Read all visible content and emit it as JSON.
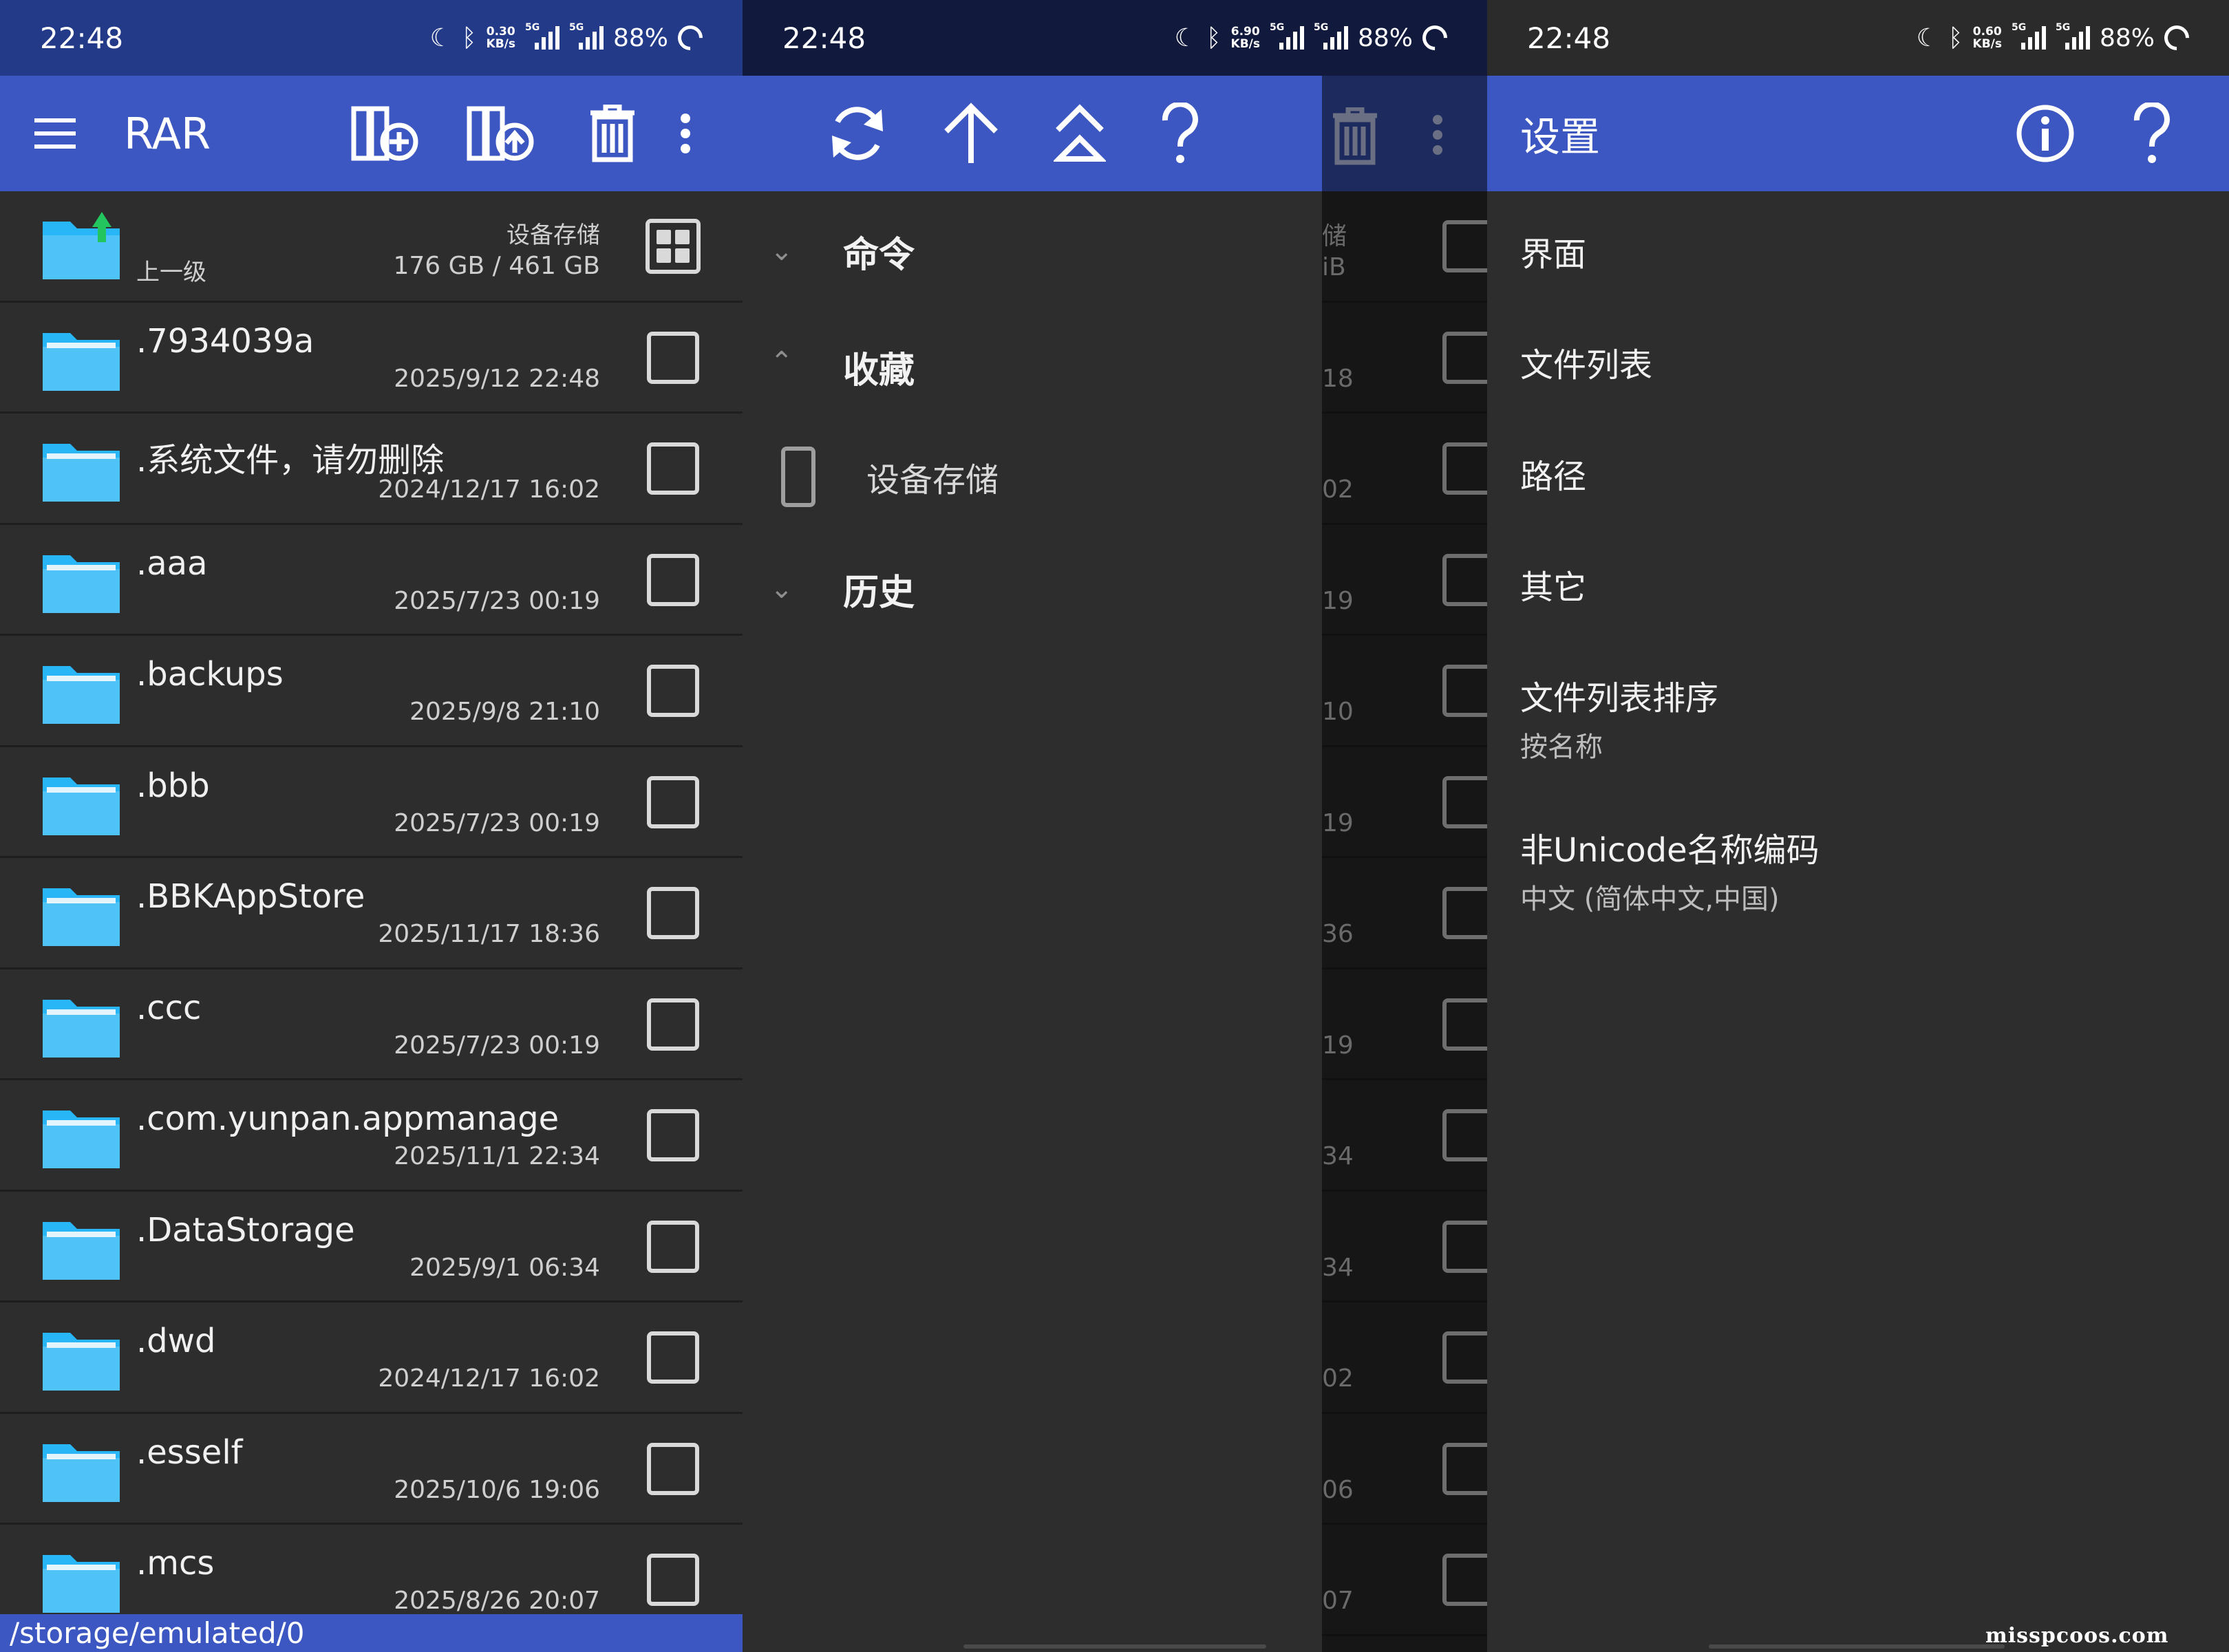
{
  "status_bars": [
    {
      "time": "22:48",
      "speed": "0.30",
      "speed_unit": "KB/s",
      "net": "5G",
      "battery": "88%"
    },
    {
      "time": "22:48",
      "speed": "6.90",
      "speed_unit": "KB/s",
      "net": "5G",
      "battery": "88%"
    },
    {
      "time": "22:48",
      "speed": "0.60",
      "speed_unit": "KB/s",
      "net": "5G",
      "battery": "88%"
    }
  ],
  "panel1": {
    "app_title": "RAR",
    "toolbar_icons": [
      "menu-icon",
      "add-to-archive-icon",
      "extract-icon",
      "delete-icon",
      "more-vert-icon"
    ],
    "parent_row": {
      "label": "上一级",
      "storage_label": "设备存储",
      "storage_size": "176 GB / 461 GB"
    },
    "files": [
      {
        "name": ".7934039a",
        "date": "2025/9/12 22:48"
      },
      {
        "name": ".系统文件，请勿删除",
        "date": "2024/12/17 16:02"
      },
      {
        "name": ".aaa",
        "date": "2025/7/23 00:19"
      },
      {
        "name": ".backups",
        "date": "2025/9/8 21:10"
      },
      {
        "name": ".bbb",
        "date": "2025/7/23 00:19"
      },
      {
        "name": ".BBKAppStore",
        "date": "2025/11/17 18:36"
      },
      {
        "name": ".ccc",
        "date": "2025/7/23 00:19"
      },
      {
        "name": ".com.yunpan.appmanage",
        "date": "2025/11/1 22:34"
      },
      {
        "name": ".DataStorage",
        "date": "2025/9/1 06:34"
      },
      {
        "name": ".dwd",
        "date": "2024/12/17 16:02"
      },
      {
        "name": ".esself",
        "date": "2025/10/6 19:06"
      },
      {
        "name": ".mcs",
        "date": "2025/8/26 20:07"
      }
    ],
    "path": "/storage/emulated/0"
  },
  "panel2": {
    "toolbar_icons": [
      "refresh-icon",
      "arrow-up-icon",
      "root-icon",
      "help-icon"
    ],
    "drawer": {
      "commands": "命令",
      "favorites": "收藏",
      "device_storage": "设备存储",
      "history": "历史"
    },
    "dim_labels": [
      "储",
      "iB",
      "18",
      "02",
      "19",
      "10",
      "19",
      "36",
      "19",
      "34",
      "34",
      "02",
      "06",
      "07"
    ]
  },
  "panel3": {
    "title": "设置",
    "items": [
      {
        "title": "界面",
        "subtitle": ""
      },
      {
        "title": "文件列表",
        "subtitle": ""
      },
      {
        "title": "路径",
        "subtitle": ""
      },
      {
        "title": "其它",
        "subtitle": ""
      },
      {
        "title": "文件列表排序",
        "subtitle": "按名称"
      },
      {
        "title": "非Unicode名称编码",
        "subtitle": "中文 (简体中文,中国)"
      }
    ]
  },
  "watermark": "misspcoos.com",
  "colors": {
    "appbar": "#3d57c2",
    "statusbar": "#233a88",
    "background": "#2d2d2d",
    "folder": "#29b6f6",
    "up_arrow": "#22c55e"
  }
}
